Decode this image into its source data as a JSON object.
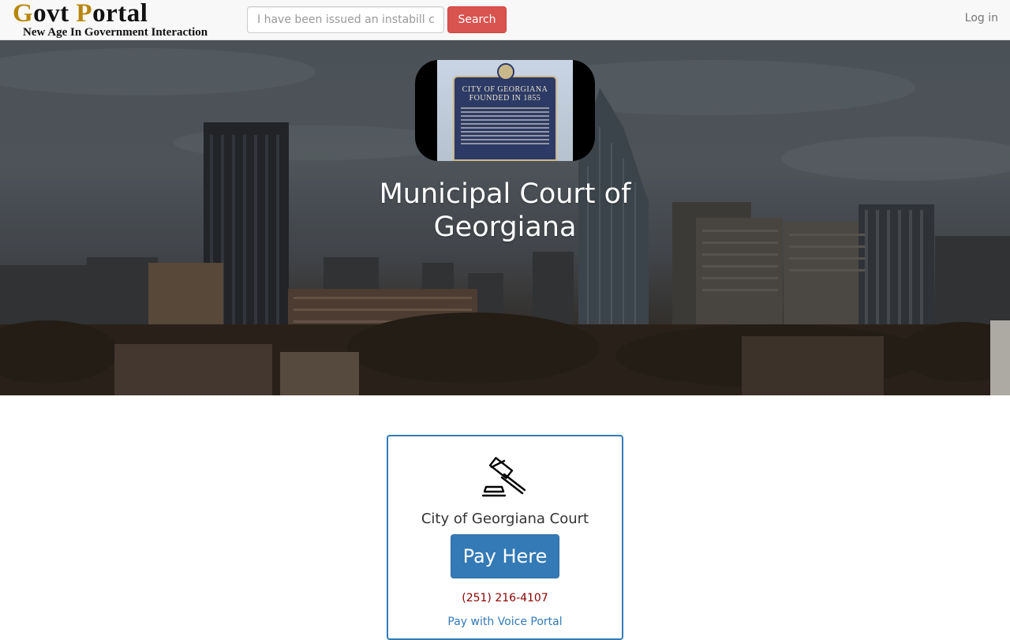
{
  "navbar": {
    "brand": {
      "title_initial_1": "G",
      "title_rest_1": "ovt ",
      "title_initial_2": "P",
      "title_rest_2": "ortal",
      "tagline": "New Age In Government Interaction"
    },
    "search": {
      "placeholder": "I have been issued an instabill c",
      "button_label": "Search"
    },
    "login_label": "Log in"
  },
  "hero": {
    "seal": {
      "sign_title": "CITY OF GEORGIANA\nFOUNDED IN 1855"
    },
    "title": "Municipal Court of Georgiana"
  },
  "card": {
    "icon": "gavel-icon",
    "court_name": "City of Georgiana Court",
    "pay_button_label": "Pay Here",
    "phone": "(251) 216-4107",
    "voice_portal_label": "Pay with Voice Portal"
  },
  "colors": {
    "brand_accent": "#b8860b",
    "search_button": "#d9534f",
    "primary": "#337ab7",
    "phone_text": "#8b0000"
  }
}
